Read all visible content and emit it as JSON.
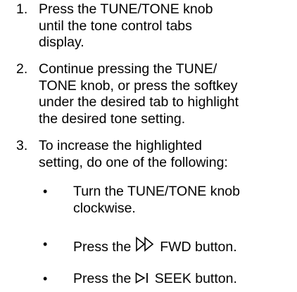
{
  "steps": [
    {
      "number": "1.",
      "lines": [
        "Press the TUNE/TONE knob",
        "until the tone control tabs",
        "display."
      ]
    },
    {
      "number": "2.",
      "lines": [
        "Continue pressing the TUNE/",
        "TONE knob, or press the softkey",
        "under the desired tab to highlight",
        "the desired tone setting."
      ]
    },
    {
      "number": "3.",
      "lines": [
        "To increase the highlighted",
        "setting, do one of the following:"
      ]
    }
  ],
  "bullets": [
    {
      "marker": "•",
      "lines": [
        "Turn the TUNE/TONE knob",
        "clockwise."
      ]
    },
    {
      "marker": "•",
      "before": "Press the",
      "icon": "fast-forward-icon",
      "after": "FWD button."
    },
    {
      "marker": "•",
      "before": "Press the",
      "icon": "seek-next-icon",
      "after": "SEEK button."
    }
  ]
}
